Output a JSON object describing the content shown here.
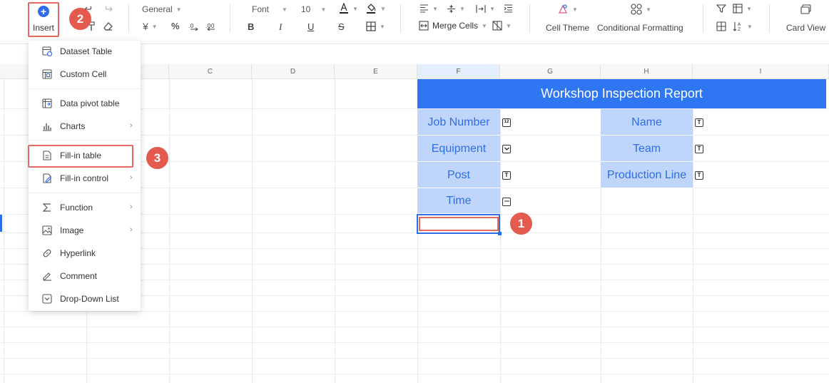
{
  "toolbar": {
    "insert_label": "Insert",
    "number_format": "General",
    "font_name": "Font",
    "font_size": "10",
    "bold": "B",
    "italic": "I",
    "underline": "U",
    "strike": "S",
    "merge_cells": "Merge Cells",
    "cell_theme": "Cell Theme",
    "conditional_formatting": "Conditional Formatting",
    "card_view": "Card View",
    "currency_symbol": "¥",
    "percent_symbol": "%",
    "accent_color": "#2f6de6"
  },
  "columns": [
    "C",
    "D",
    "E",
    "F",
    "G",
    "H",
    "I"
  ],
  "report": {
    "title": "Workshop Inspection Report",
    "left_fields": [
      "Job Number",
      "Equipment",
      "Post",
      "Time"
    ],
    "right_fields": [
      "Name",
      "Team",
      "Production Line"
    ],
    "left_field_types": [
      "number-type-icon",
      "dropdown-type-icon",
      "text-type-icon",
      "date-type-icon"
    ],
    "right_field_types": [
      "text-type-icon",
      "text-type-icon",
      "text-type-icon"
    ],
    "title_color": "#2f76f2",
    "field_color": "#c0d5fa"
  },
  "insert_menu": {
    "items": [
      {
        "label": "Dataset Table",
        "icon": "dataset-table-icon",
        "submenu": false
      },
      {
        "label": "Custom Cell",
        "icon": "custom-cell-icon",
        "submenu": false
      },
      {
        "label": "Data pivot table",
        "icon": "pivot-table-icon",
        "submenu": false
      },
      {
        "label": "Charts",
        "icon": "charts-icon",
        "submenu": true
      },
      {
        "label": "Fill-in table",
        "icon": "fill-in-table-icon",
        "submenu": false
      },
      {
        "label": "Fill-in control",
        "icon": "fill-in-control-icon",
        "submenu": true
      },
      {
        "label": "Function",
        "icon": "function-icon",
        "submenu": true
      },
      {
        "label": "Image",
        "icon": "image-icon",
        "submenu": true
      },
      {
        "label": "Hyperlink",
        "icon": "hyperlink-icon",
        "submenu": false
      },
      {
        "label": "Comment",
        "icon": "comment-icon",
        "submenu": false
      },
      {
        "label": "Drop-Down List",
        "icon": "dropdown-list-icon",
        "submenu": false
      }
    ]
  },
  "steps": {
    "one": "1",
    "two": "2",
    "three": "3"
  },
  "highlight_color": "#e56a62"
}
